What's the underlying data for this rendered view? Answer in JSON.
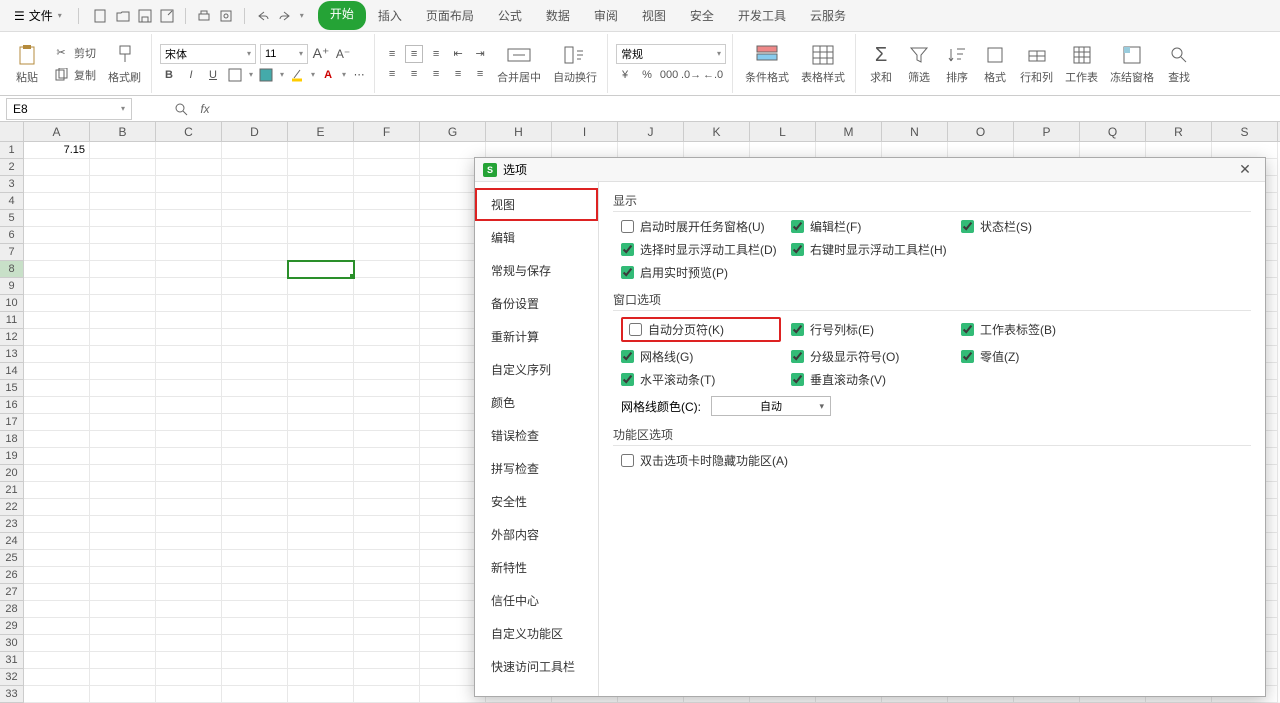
{
  "menu": {
    "file": "文件"
  },
  "tabs": [
    "开始",
    "插入",
    "页面布局",
    "公式",
    "数据",
    "审阅",
    "视图",
    "安全",
    "开发工具",
    "云服务"
  ],
  "active_tab": 0,
  "ribbon": {
    "paste": "粘贴",
    "cut": "剪切",
    "copy": "复制",
    "format_painter": "格式刷",
    "font_name": "宋体",
    "font_size": "11",
    "number_format": "常规",
    "merge_center": "合并居中",
    "wrap_text": "自动换行",
    "cond_format": "条件格式",
    "table_style": "表格样式",
    "sum": "求和",
    "filter": "筛选",
    "sort": "排序",
    "format": "格式",
    "row_col": "行和列",
    "worksheet": "工作表",
    "freeze": "冻结窗格",
    "find": "查找"
  },
  "namebox": "E8",
  "cell_a1": "7.15",
  "columns": [
    "A",
    "B",
    "C",
    "D",
    "E",
    "F",
    "G",
    "H",
    "I",
    "J",
    "K",
    "L",
    "M",
    "N",
    "O",
    "P",
    "Q",
    "R",
    "S"
  ],
  "dialog": {
    "title": "选项",
    "close": "✕",
    "sidebar": [
      "视图",
      "编辑",
      "常规与保存",
      "备份设置",
      "重新计算",
      "自定义序列",
      "颜色",
      "错误检查",
      "拼写检查",
      "安全性",
      "外部内容",
      "新特性",
      "信任中心",
      "自定义功能区",
      "快速访问工具栏"
    ],
    "section_display": "显示",
    "display": {
      "taskpane": "启动时展开任务窗格(U)",
      "editbar": "编辑栏(F)",
      "statusbar": "状态栏(S)",
      "sel_float": "选择时显示浮动工具栏(D)",
      "right_float": "右键时显示浮动工具栏(H)",
      "live_preview": "启用实时预览(P)"
    },
    "section_window": "窗口选项",
    "window": {
      "auto_page_break": "自动分页符(K)",
      "row_col_header": "行号列标(E)",
      "sheet_tabs": "工作表标签(B)",
      "gridlines": "网格线(G)",
      "outline": "分级显示符号(O)",
      "zero": "零值(Z)",
      "hscroll": "水平滚动条(T)",
      "vscroll": "垂直滚动条(V)",
      "grid_color_label": "网格线颜色(C):",
      "grid_color_value": "自动"
    },
    "section_ribbon": "功能区选项",
    "ribbon_opt": {
      "dbl_hide": "双击选项卡时隐藏功能区(A)"
    }
  }
}
